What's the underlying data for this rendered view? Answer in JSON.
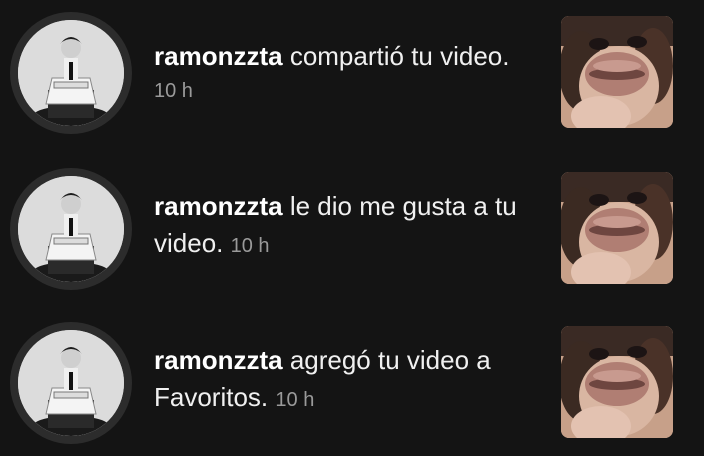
{
  "notifications": [
    {
      "username": "ramonzzta",
      "message": "compartió tu video.",
      "time": "10 h",
      "avatar_icon": "user-avatar",
      "thumbnail_icon": "video-thumbnail"
    },
    {
      "username": "ramonzzta",
      "message_line1": "le dio me gusta a tu",
      "message_line2": "video.",
      "time": "10 h",
      "avatar_icon": "user-avatar",
      "thumbnail_icon": "video-thumbnail"
    },
    {
      "username": "ramonzzta",
      "message_line1": "agregó tu video a",
      "message_line2": "Favoritos.",
      "time": "10 h",
      "avatar_icon": "user-avatar",
      "thumbnail_icon": "video-thumbnail"
    }
  ],
  "colors": {
    "background": "#141414",
    "ring": "#2c2c2c",
    "time": "#9a9a9a",
    "text": "#f0f0f0"
  }
}
